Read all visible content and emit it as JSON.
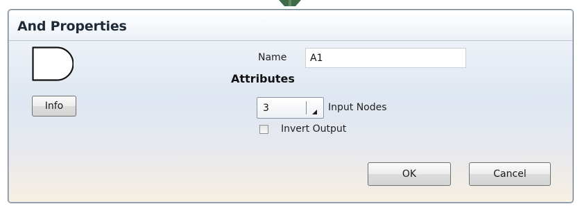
{
  "dialog": {
    "title": "And Properties"
  },
  "gate": {
    "icon": "and-gate-icon",
    "info_label": "Info"
  },
  "name_field": {
    "label": "Name",
    "value": "A1"
  },
  "attributes": {
    "heading": "Attributes",
    "input_nodes": {
      "selected": "3",
      "label": "Input Nodes"
    },
    "invert_output": {
      "label": "Invert Output",
      "checked": false
    }
  },
  "actions": {
    "ok_label": "OK",
    "cancel_label": "Cancel"
  },
  "colors": {
    "border": "#6d7d8e",
    "title_text": "#1f2a37",
    "button_border": "#707070"
  }
}
